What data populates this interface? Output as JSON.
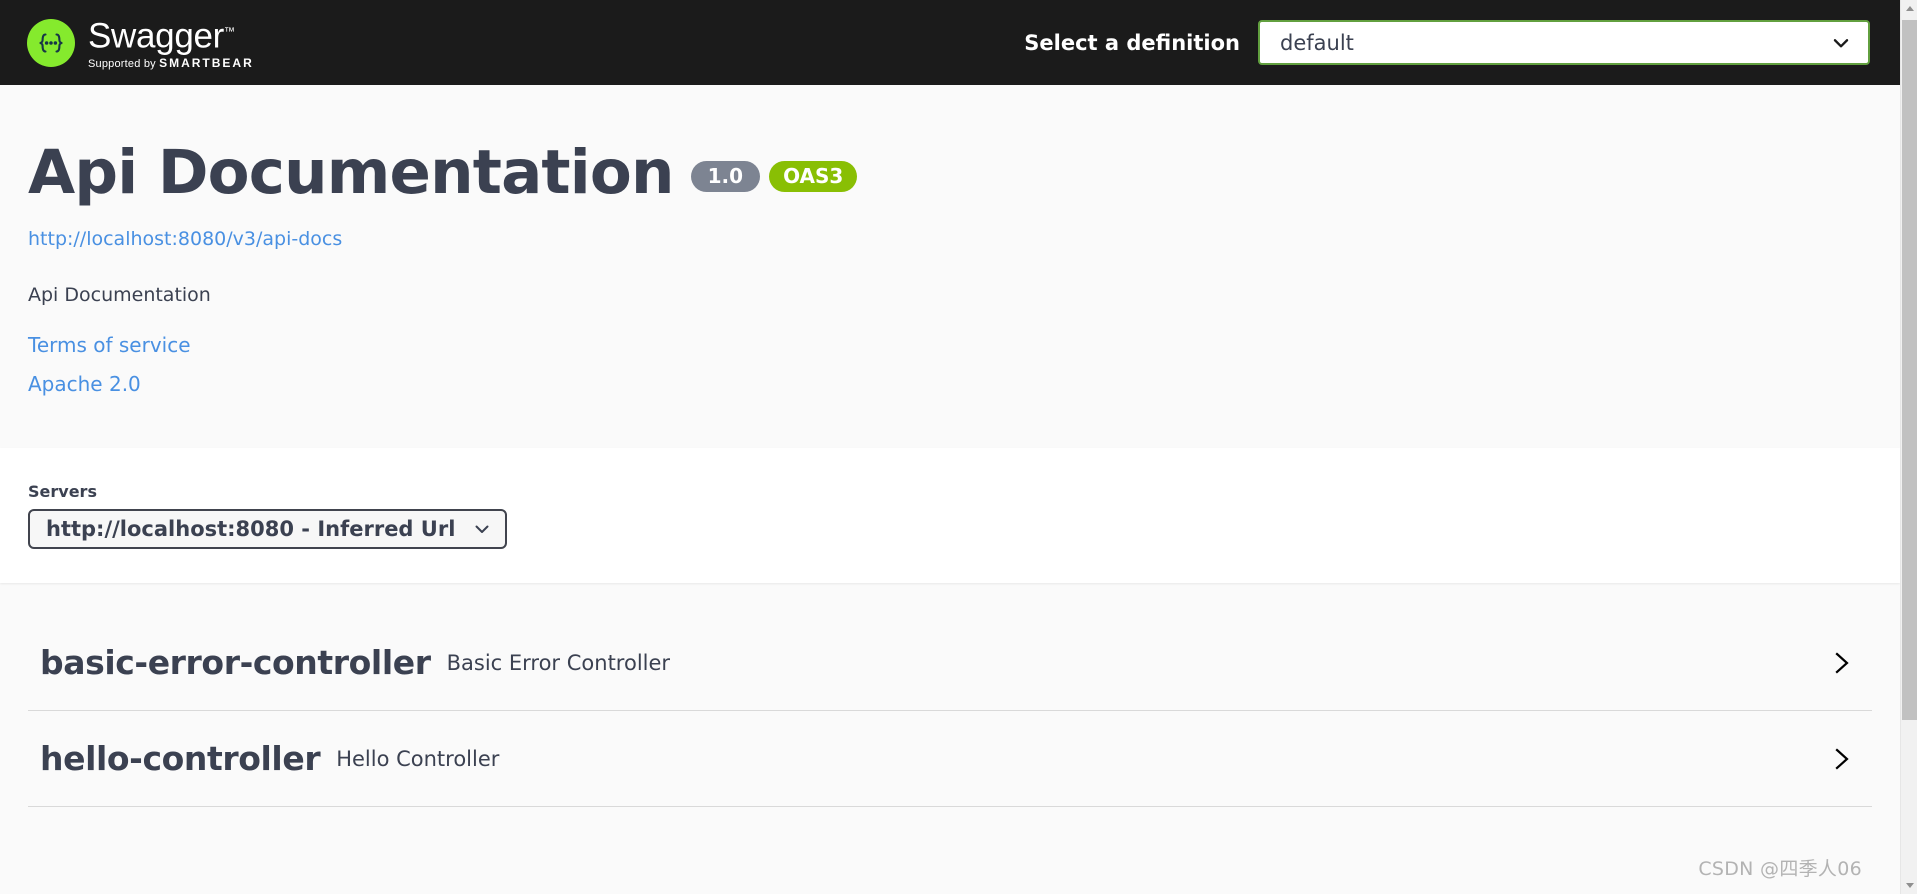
{
  "topbar": {
    "logo_word": "Swagger",
    "logo_tm": "™",
    "logo_supported_prefix": "Supported by ",
    "logo_supported_brand": "SMARTBEAR",
    "definition_label": "Select a definition",
    "definition_value": "default",
    "definition_options": [
      "default"
    ],
    "chevron_icon": "chevron-down-icon",
    "background_color": "#1b1b1b",
    "accent_green": "#85ea2d",
    "select_border_color": "#62a03f"
  },
  "info": {
    "title": "Api Documentation",
    "version_badge": "1.0",
    "oas_badge": "OAS3",
    "docs_url": "http://localhost:8080/v3/api-docs",
    "description": "Api Documentation",
    "terms_link": "Terms of service",
    "license_link": "Apache 2.0",
    "version_badge_color": "#7d8492",
    "oas_badge_color": "#89bf04",
    "link_color": "#4990e2",
    "text_color": "#3b4151"
  },
  "servers": {
    "label": "Servers",
    "selected": "http://localhost:8080 - Inferred Url",
    "options": [
      "http://localhost:8080 - Inferred Url"
    ],
    "chevron_icon": "chevron-down-icon"
  },
  "tags": [
    {
      "name": "basic-error-controller",
      "description": "Basic Error Controller",
      "expand_icon": "chevron-right-icon",
      "expanded": false
    },
    {
      "name": "hello-controller",
      "description": "Hello Controller",
      "expand_icon": "chevron-right-icon",
      "expanded": false
    }
  ],
  "scrollbar": {
    "up_arrow_icon": "triangle-up-icon",
    "down_arrow_icon": "triangle-down-icon"
  },
  "watermark": "CSDN @四季人06"
}
